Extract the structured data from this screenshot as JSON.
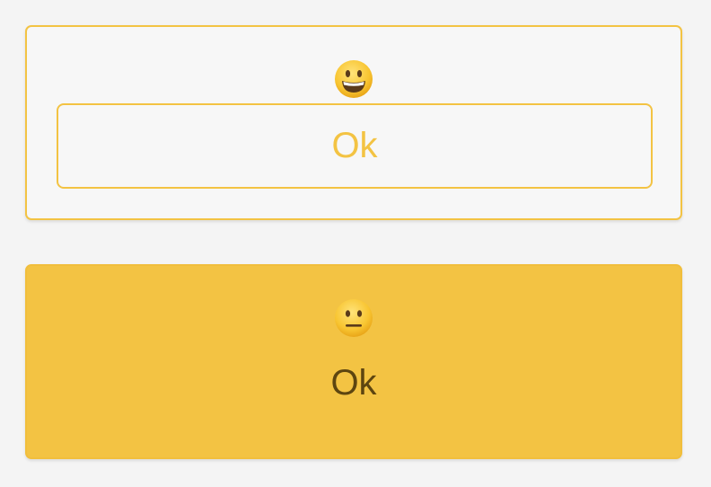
{
  "cards": [
    {
      "emoji_icon": "grinning-face-icon",
      "button_label": "Ok",
      "style": "outline",
      "accent": "#f3c343"
    },
    {
      "emoji_icon": "neutral-face-icon",
      "button_label": "Ok",
      "style": "filled",
      "accent": "#f3c343",
      "text_color": "#5d4510"
    }
  ]
}
